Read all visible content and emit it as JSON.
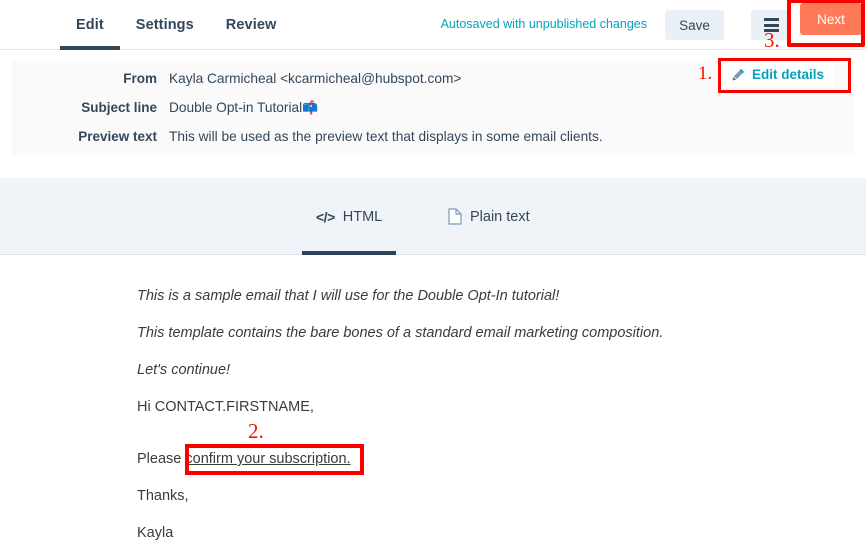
{
  "topbar": {
    "tabs": [
      {
        "label": "Edit",
        "active": true
      },
      {
        "label": "Settings",
        "active": false
      },
      {
        "label": "Review",
        "active": false
      }
    ],
    "autosave_status": "Autosaved with unpublished changes",
    "save_label": "Save",
    "menu_icon": "hamburger-menu-icon",
    "next_label": "Next",
    "accent_color": "#ff7a59",
    "teal_color": "#00a4bd",
    "navy_color": "#33475b"
  },
  "details": {
    "rows": [
      {
        "label": "From",
        "value": "Kayla Carmicheal <kcarmicheal@hubspot.com>"
      },
      {
        "label": "Subject line",
        "value": "Double Opt-in Tutorial",
        "emoji": "📫"
      },
      {
        "label": "Preview text",
        "value": "This will be used as the preview text that displays in some email clients."
      }
    ],
    "edit_details_label": "Edit details",
    "edit_details_icon": "pencil-icon"
  },
  "content_tabs": [
    {
      "label": "HTML",
      "icon": "code-icon",
      "active": true
    },
    {
      "label": "Plain text",
      "icon": "document-icon",
      "active": false
    }
  ],
  "email_body": {
    "lines": [
      {
        "text": "This is a sample email that I will use for the Double Opt-In tutorial!",
        "italic": true
      },
      {
        "text": "This template contains the bare bones of a standard email marketing composition.",
        "italic": true
      },
      {
        "text": "Let's continue!",
        "italic": true
      },
      {
        "text": "Hi CONTACT.FIRSTNAME,",
        "italic": false
      },
      {
        "text": "Thanks,",
        "italic": false
      },
      {
        "text": "Kayla",
        "italic": false
      }
    ],
    "link_line": {
      "prefix": "Please ",
      "link_text": "confirm your subscription."
    }
  },
  "annotations": {
    "color": "#fc0000",
    "markers": [
      {
        "number": "1.",
        "target": "edit-details-button"
      },
      {
        "number": "2.",
        "target": "confirm-subscription-link"
      },
      {
        "number": "3.",
        "target": "next-button"
      }
    ]
  }
}
